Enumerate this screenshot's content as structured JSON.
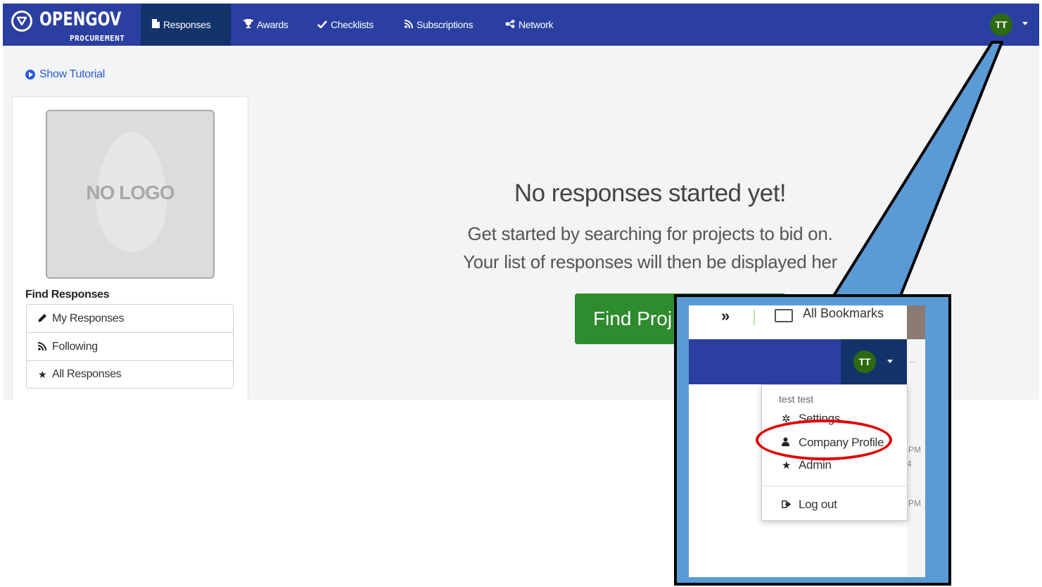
{
  "brand": {
    "name": "OPENGOV",
    "sub": "PROCUREMENT"
  },
  "nav": {
    "items": [
      {
        "label": "Responses",
        "icon": "file-icon",
        "glyph": "🗎"
      },
      {
        "label": "Awards",
        "icon": "trophy-icon",
        "glyph": "🏆"
      },
      {
        "label": "Checklists",
        "icon": "check-icon",
        "glyph": "✔"
      },
      {
        "label": "Subscriptions",
        "icon": "rss-icon",
        "glyph": "҅"
      },
      {
        "label": "Network",
        "icon": "share-icon",
        "glyph": "<"
      }
    ],
    "user_initials": "TT"
  },
  "tutorial": {
    "label": "Show Tutorial"
  },
  "sidebar": {
    "logo_placeholder": "NO LOGO",
    "find_title": "Find Responses",
    "items": [
      {
        "label": "My Responses",
        "icon": "pencil-icon",
        "glyph": "✎"
      },
      {
        "label": "Following",
        "icon": "rss-icon",
        "glyph": "ℜ"
      },
      {
        "label": "All Responses",
        "icon": "star-icon",
        "glyph": "★"
      }
    ]
  },
  "empty": {
    "title": "No responses started yet!",
    "line1": "Get started by searching for projects to bid on.",
    "line2": "Your list of responses will then be displayed her",
    "button": "Find Proj"
  },
  "zoom": {
    "bookmarks_chevron": "»",
    "bookmarks_label": "All Bookmarks",
    "user_initials": "TT",
    "menu": {
      "user_name": "test test",
      "items": [
        {
          "label": "Settings",
          "icon": "gear-icon",
          "glyph": "✲"
        },
        {
          "label": "Company Profile",
          "icon": "user-icon",
          "glyph": "👤"
        },
        {
          "label": "Admin",
          "icon": "star-icon",
          "glyph": "★"
        },
        {
          "label": "Log out",
          "icon": "logout-icon",
          "glyph": "↦"
        }
      ]
    },
    "side_fragments": [
      "...",
      "PM",
      "4",
      "PM"
    ]
  },
  "colors": {
    "nav": "#2a3fa0",
    "nav_active": "#13336b",
    "avatar": "#2c6a12",
    "button": "#2e8b2e",
    "callout": "#5b9bd5",
    "highlight": "#e00000"
  }
}
